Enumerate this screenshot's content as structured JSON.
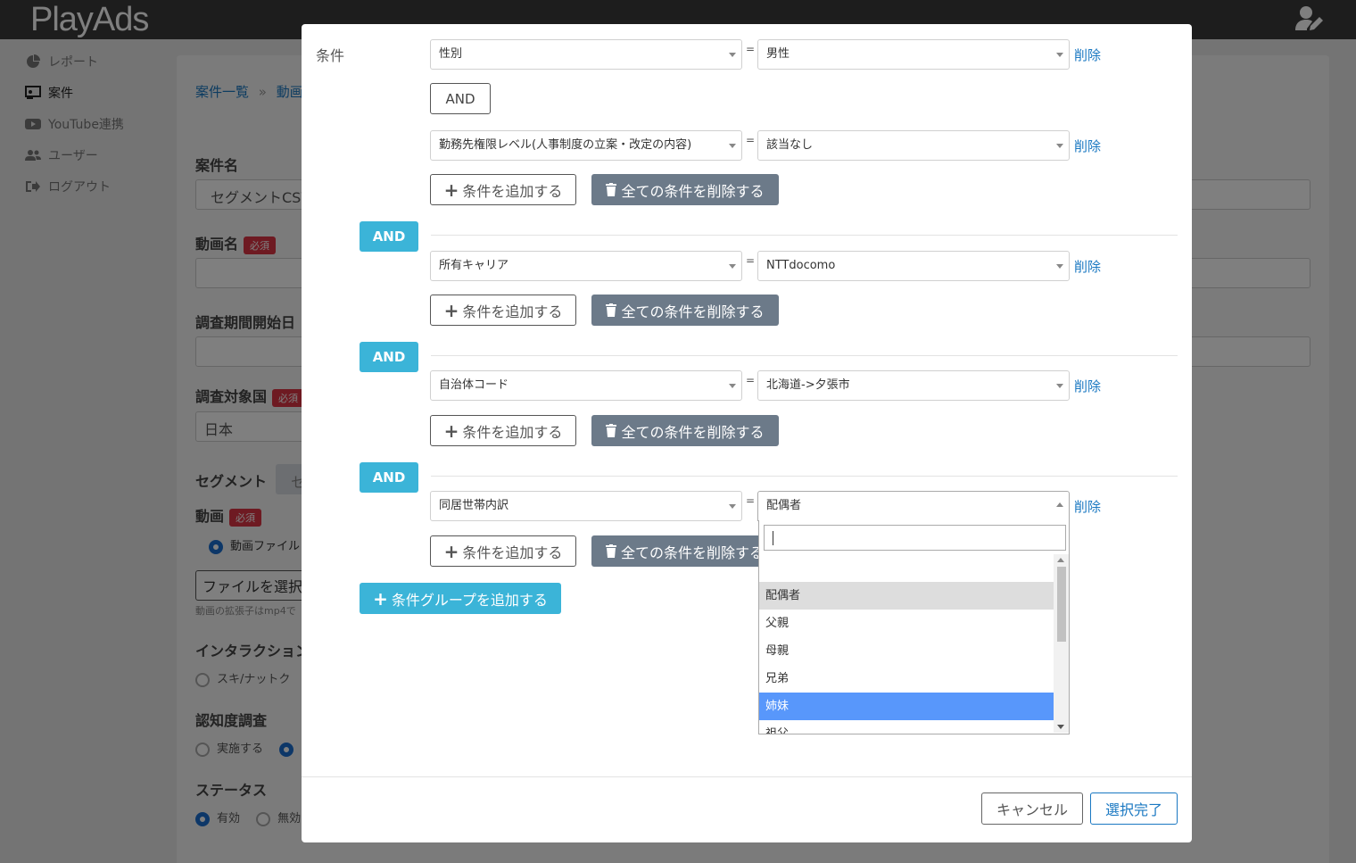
{
  "app": {
    "logo_text": "PlayAds"
  },
  "sidebar": {
    "items": [
      {
        "label": "レポート"
      },
      {
        "label": "案件"
      },
      {
        "label": "YouTube連携"
      },
      {
        "label": "ユーザー"
      },
      {
        "label": "ログアウト"
      }
    ]
  },
  "background_form": {
    "breadcrumb": {
      "list": "案件一覧",
      "sep": "»",
      "current": "動画"
    },
    "campaign_name_label": "案件名",
    "campaign_name_value": "セグメントCSV",
    "video_name_label": "動画名",
    "required_badge": "必須",
    "period_label": "調査期間開始日",
    "country_label": "調査対象国",
    "country_value": "日本",
    "segment_label": "セグメント",
    "segment_button_partial": "セ",
    "video_label": "動画",
    "video_file_option": "動画ファイル",
    "file_button": "ファイルを選択",
    "file_hint": "動画の拡張子はmp4で",
    "interaction_label": "インタラクション",
    "interaction_option": "スキ/ナットク",
    "awareness_label": "認知度調査",
    "awareness_option_yes": "実施する",
    "status_label": "ステータス",
    "status_active": "有効",
    "status_inactive": "無効"
  },
  "modal": {
    "condition_label": "条件",
    "equals": "=",
    "delete_label": "削除",
    "and_button": "AND",
    "add_condition_button": "条件を追加する",
    "delete_all_button": "全ての条件を削除する",
    "add_group_button": "条件グループを追加する",
    "and_badge": "AND",
    "groups": [
      {
        "conditions": [
          {
            "field": "性別",
            "value": "男性"
          },
          {
            "field": "勤務先権限レベル(人事制度の立案・改定の内容)",
            "value": "該当なし"
          }
        ]
      },
      {
        "conditions": [
          {
            "field": "所有キャリア",
            "value": "NTTdocomo"
          }
        ]
      },
      {
        "conditions": [
          {
            "field": "自治体コード",
            "value": "北海道->夕張市"
          }
        ]
      },
      {
        "conditions": [
          {
            "field": "同居世帯内訳",
            "value": "配偶者"
          }
        ]
      }
    ],
    "cancel_button": "キャンセル",
    "done_button": "選択完了"
  },
  "dropdown": {
    "search_value": "",
    "options": [
      "",
      "配偶者",
      "父親",
      "母親",
      "兄弟",
      "姉妹",
      "祖父"
    ],
    "selected": "配偶者",
    "highlighted": "姉妹"
  },
  "colors": {
    "topbar": "#3b3b3b",
    "link": "#1a78c2",
    "info_button": "#3bb4d8",
    "gray_button": "#6c7a89",
    "highlight": "#5897fb",
    "badge": "#dc3545"
  }
}
